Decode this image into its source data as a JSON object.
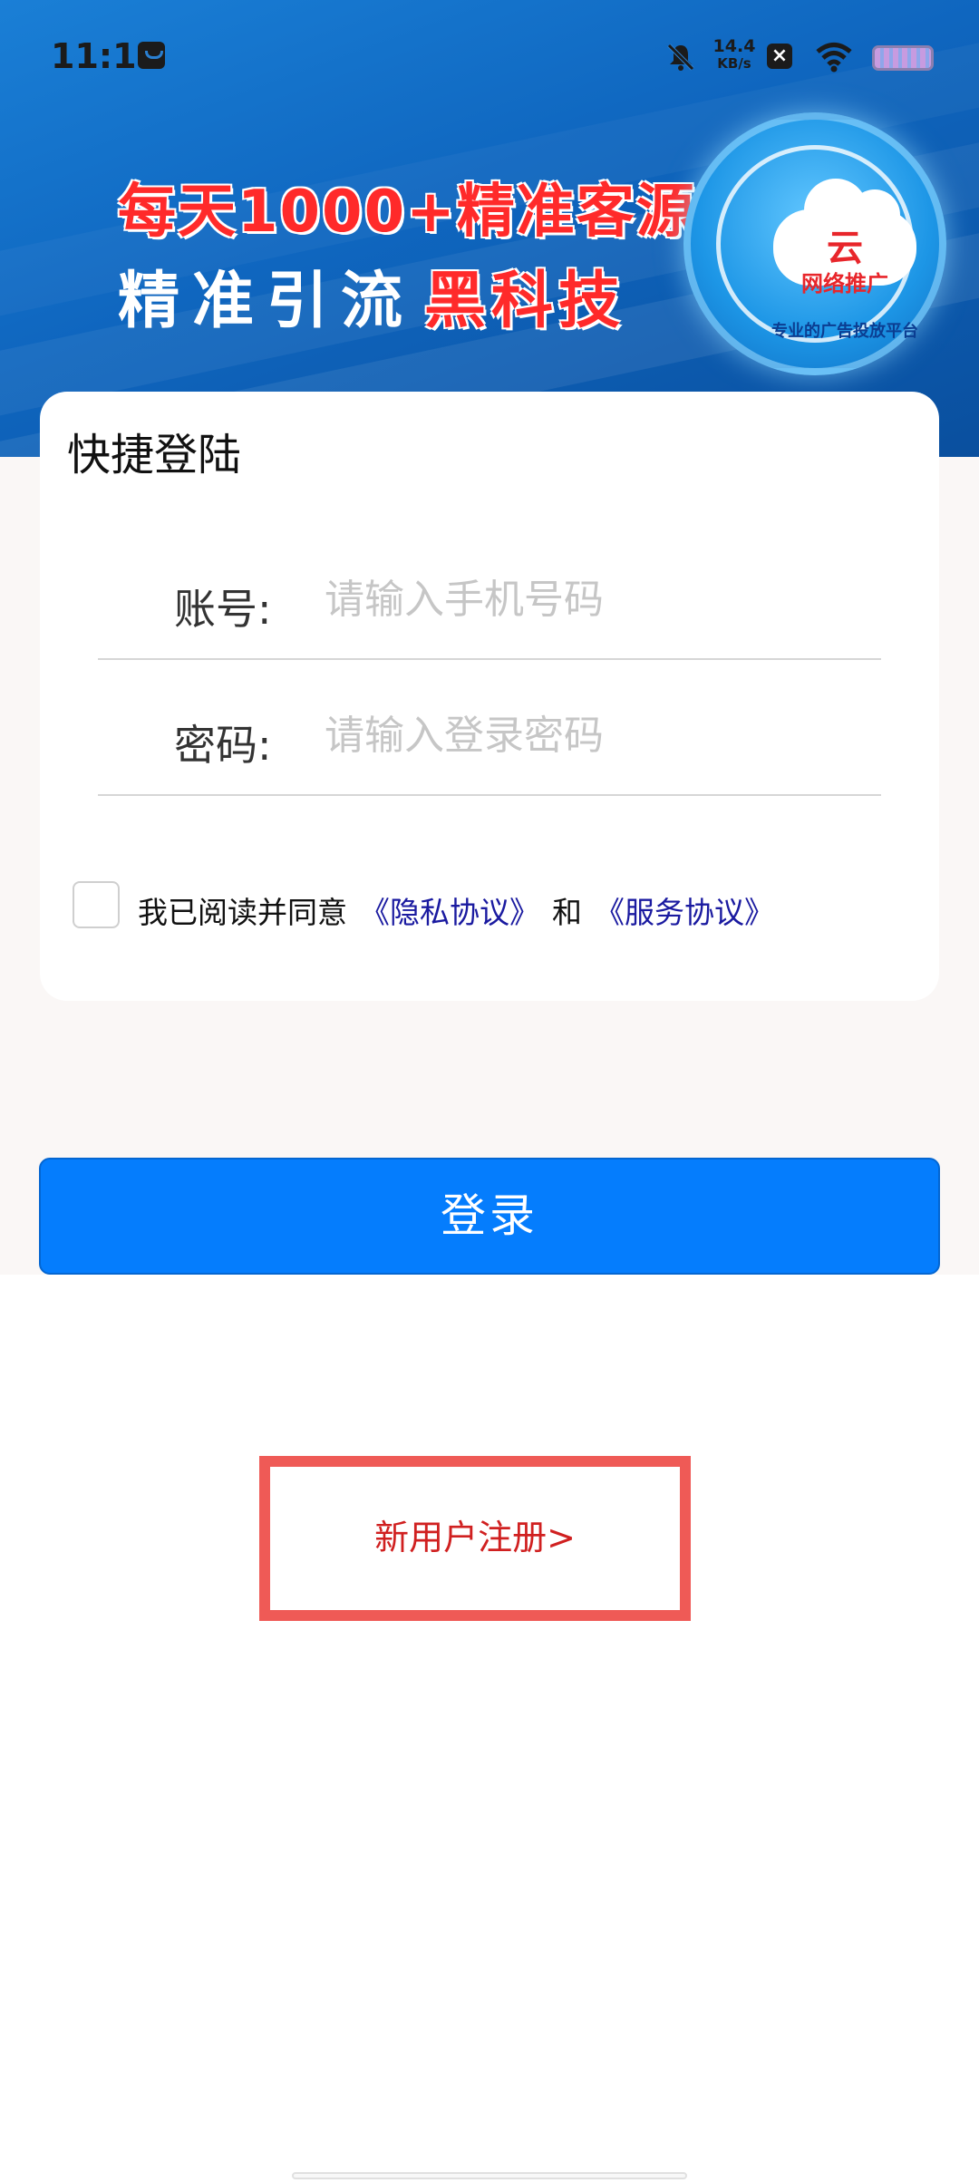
{
  "status_bar": {
    "time": "11:14",
    "net_speed_value": "14.4",
    "net_speed_unit": "KB/s",
    "icons": [
      "app-notification-icon",
      "mute-icon",
      "close-box-icon",
      "wifi-icon",
      "battery-icon"
    ]
  },
  "banner": {
    "slogan_line1": "每天1000+精准客源",
    "slogan_line2_white": "精准引流",
    "slogan_line2_red": "黑科技",
    "badge": {
      "cloud_char": "云",
      "title": "网络推广",
      "subtitle": "专业的广告投放平台"
    }
  },
  "login_card": {
    "title": "快捷登陆",
    "account": {
      "label": "账号:",
      "placeholder": "请输入手机号码",
      "value": ""
    },
    "password": {
      "label": "密码:",
      "placeholder": "请输入登录密码",
      "value": ""
    },
    "agreement": {
      "checked": false,
      "prefix": "我已阅读并同意",
      "privacy_link": "《隐私协议》",
      "conjunction": "和",
      "service_link": "《服务协议》"
    }
  },
  "login_button": {
    "label": "登录"
  },
  "register": {
    "label": "新用户注册>"
  },
  "colors": {
    "primary_button": "#057dfd",
    "link_blue": "#1a1aa0",
    "register_red": "#d02020",
    "highlight_box": "#ef5a56"
  }
}
